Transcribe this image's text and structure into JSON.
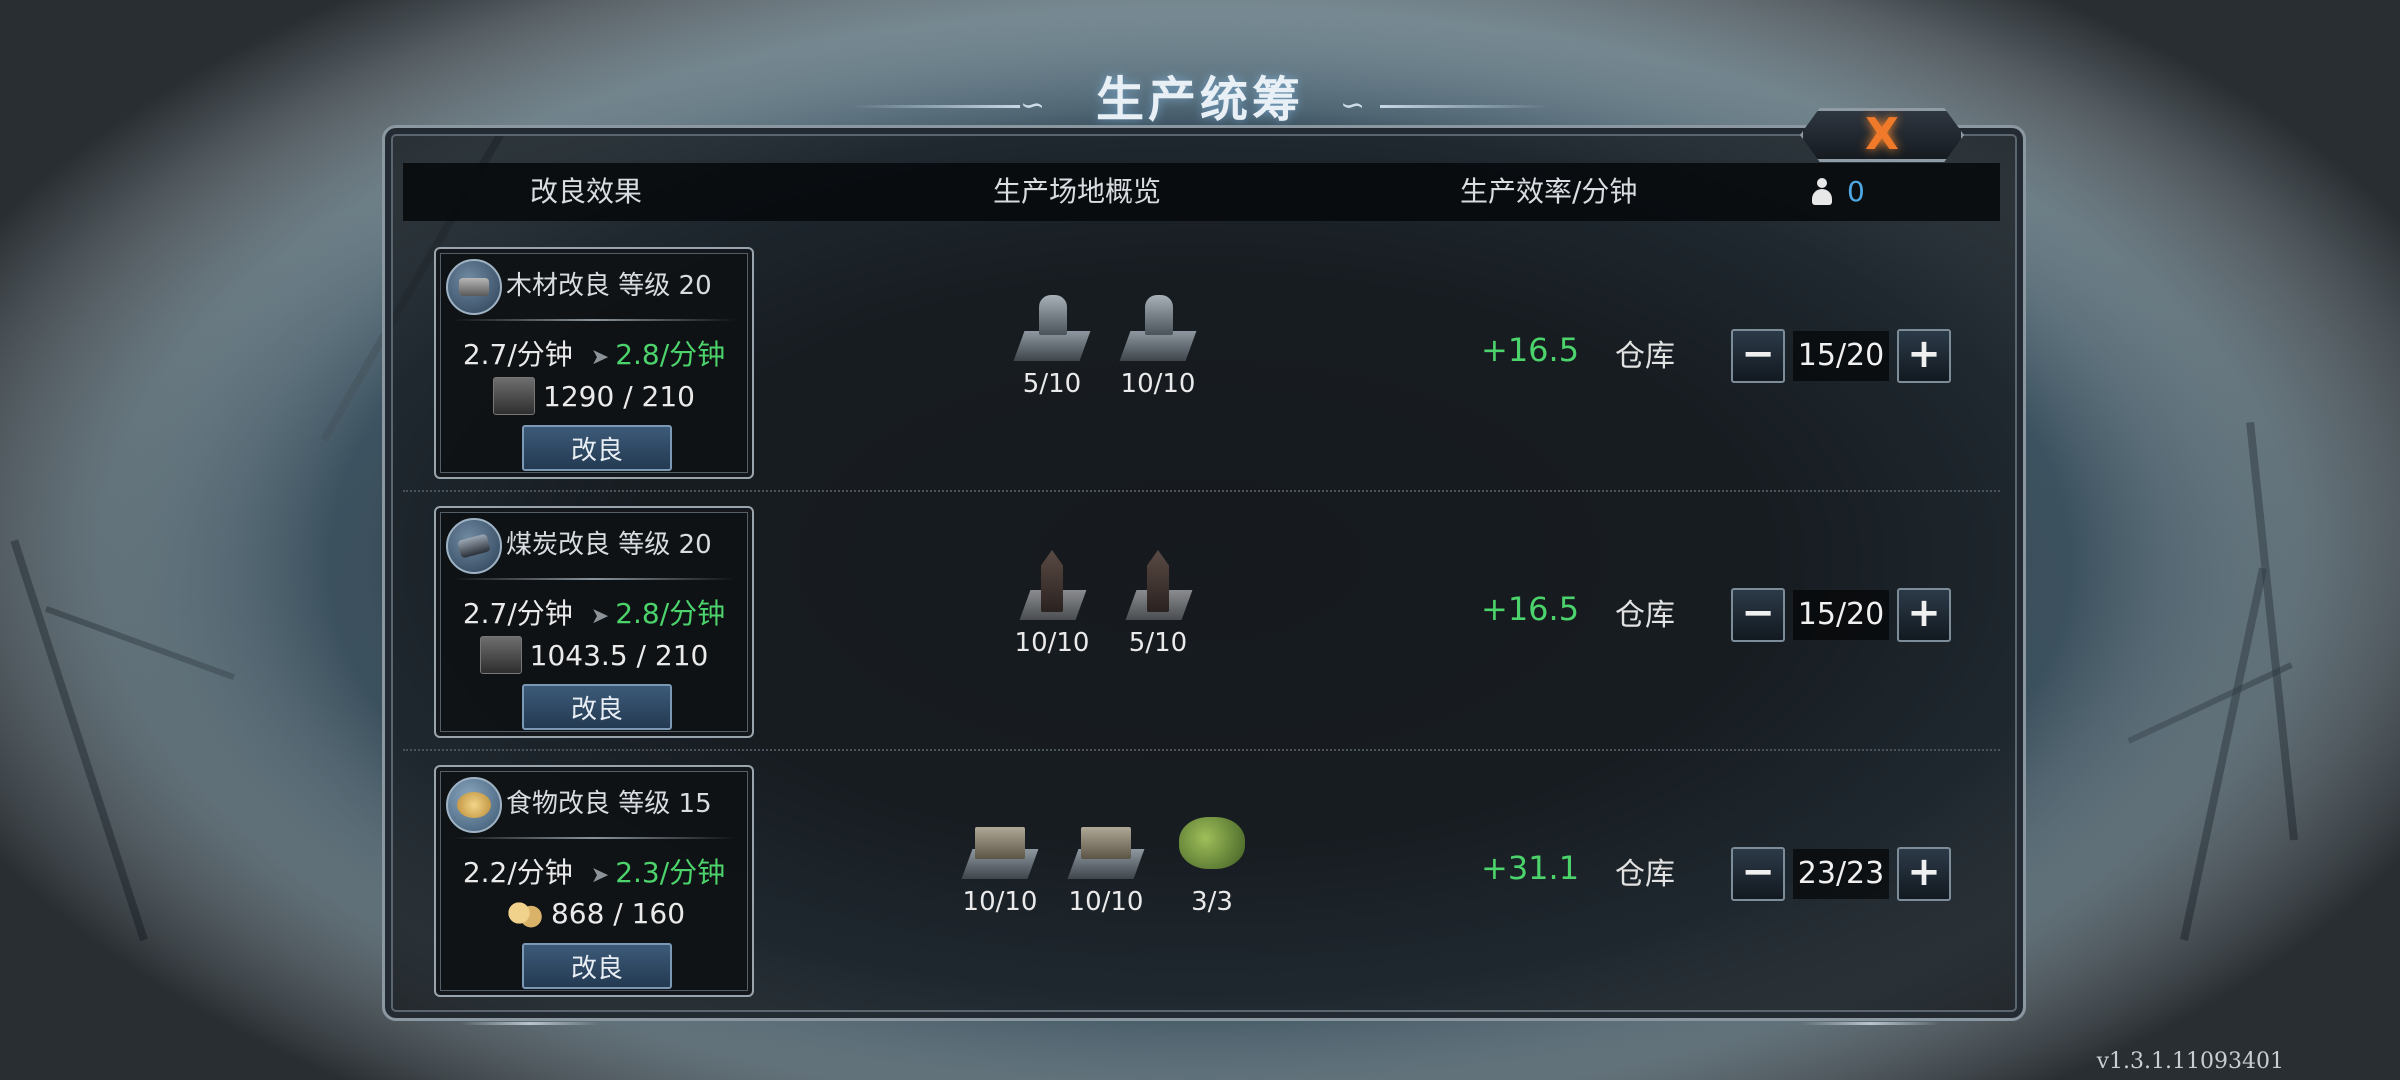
{
  "title": "生产统筹",
  "close_label": "X",
  "header": {
    "col_improve": "改良效果",
    "col_overview": "生产场地概览",
    "col_rate": "生产效率/分钟",
    "workers_available": "0"
  },
  "rows": [
    {
      "improve": {
        "icon": "wood-icon",
        "title": "木材改良 等级 20",
        "current_rate": "2.7/分钟",
        "next_rate": "2.8/分钟",
        "cost": "1290 / 210",
        "button": "改良"
      },
      "buildings": [
        {
          "icon": "sawmill-icon",
          "count": "5/10"
        },
        {
          "icon": "sawmill-icon",
          "count": "10/10"
        }
      ],
      "gain": "+16.5",
      "storage": "仓库",
      "workers": "15/20"
    },
    {
      "improve": {
        "icon": "coal-icon",
        "title": "煤炭改良 等级 20",
        "current_rate": "2.7/分钟",
        "next_rate": "2.8/分钟",
        "cost": "1043.5 / 210",
        "button": "改良"
      },
      "buildings": [
        {
          "icon": "coal-mine-icon",
          "count": "10/10"
        },
        {
          "icon": "coal-mine-icon",
          "count": "5/10"
        }
      ],
      "gain": "+16.5",
      "storage": "仓库",
      "workers": "15/20"
    },
    {
      "improve": {
        "icon": "food-icon",
        "title": "食物改良 等级 15",
        "current_rate": "2.2/分钟",
        "next_rate": "2.3/分钟",
        "cost": "868 / 160",
        "button": "改良"
      },
      "buildings": [
        {
          "icon": "hunter-hut-icon",
          "count": "10/10"
        },
        {
          "icon": "hunter-hut-icon",
          "count": "10/10"
        },
        {
          "icon": "berry-bush-icon",
          "count": "3/3"
        }
      ],
      "gain": "+31.1",
      "storage": "仓库",
      "workers": "23/23"
    }
  ],
  "stepper": {
    "minus": "−",
    "plus": "+"
  },
  "version": "v1.3.1.11093401",
  "colors": {
    "positive": "#4cd36b",
    "workers": "#4ea7e0",
    "close": "#f07a2a"
  }
}
